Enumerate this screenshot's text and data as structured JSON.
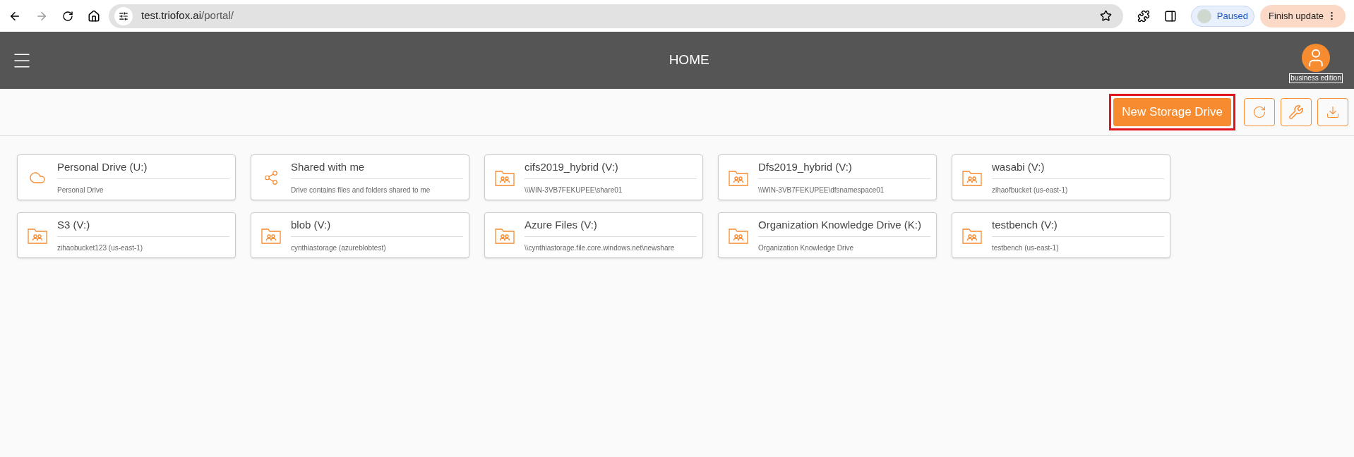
{
  "browser": {
    "url_host": "test.triofox.ai",
    "url_path": "/portal/",
    "profile": "Paused",
    "update": "Finish update"
  },
  "header": {
    "title": "HOME",
    "edition": "business edition"
  },
  "toolbar": {
    "new_button": {
      "label": "New Storage Drive",
      "highlighted": true
    }
  },
  "drives": [
    {
      "kind": "cloud",
      "name": "Personal Drive (U:)",
      "detail": "Personal Drive"
    },
    {
      "kind": "share",
      "name": "Shared with me",
      "detail": "Drive contains files and folders shared to me"
    },
    {
      "kind": "folder",
      "name": "cifs2019_hybrid (V:)",
      "detail": "\\\\WIN-3VB7FEKUPEE\\share01"
    },
    {
      "kind": "folder",
      "name": "Dfs2019_hybrid (V:)",
      "detail": "\\\\WIN-3VB7FEKUPEE\\dfsnamespace01"
    },
    {
      "kind": "folder",
      "name": "wasabi (V:)",
      "detail": "zihaofbucket (us-east-1)"
    },
    {
      "kind": "folder",
      "name": "S3 (V:)",
      "detail": "zihaobucket123 (us-east-1)"
    },
    {
      "kind": "folder",
      "name": "blob (V:)",
      "detail": "cynthiastorage (azureblobtest)"
    },
    {
      "kind": "folder",
      "name": "Azure Files (V:)",
      "detail": "\\\\cynthiastorage.file.core.windows.net\\newshare"
    },
    {
      "kind": "folder",
      "name": "Organization Knowledge Drive (K:)",
      "detail": "Organization Knowledge Drive"
    },
    {
      "kind": "folder",
      "name": "testbench (V:)",
      "detail": "testbench (us-east-1)"
    }
  ]
}
